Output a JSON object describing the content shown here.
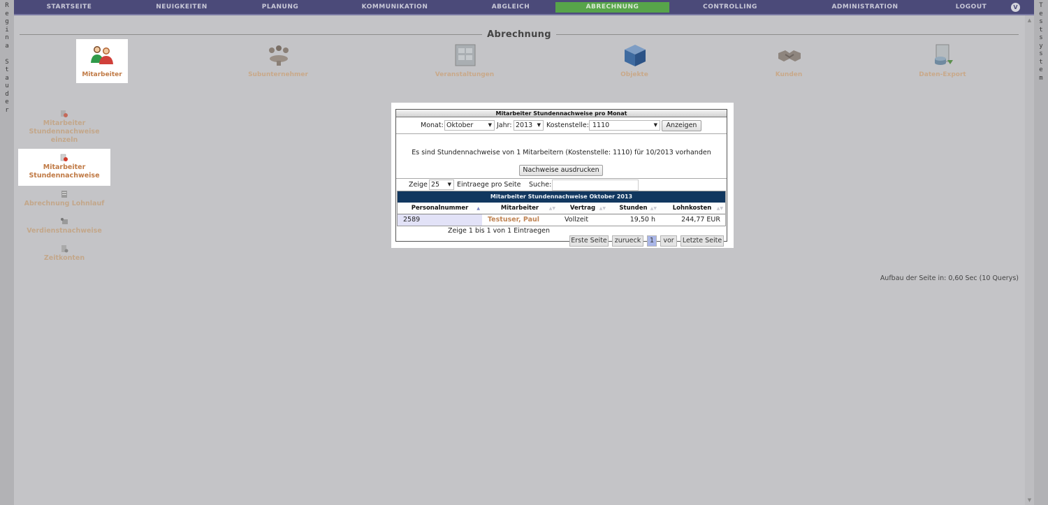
{
  "rails": {
    "left_text": [
      "R",
      "e",
      "g",
      "i",
      "n",
      "a",
      "",
      "S",
      "t",
      "a",
      "u",
      "d",
      "e",
      "r"
    ],
    "right_text": [
      "T",
      "e",
      "s",
      "t",
      "s",
      "y",
      "s",
      "t",
      "e",
      "m"
    ]
  },
  "topnav": {
    "items": [
      "STARTSEITE",
      "NEUIGKEITEN",
      "PLANUNG",
      "KOMMUNIKATION",
      "ABGLEICH",
      "ABRECHNUNG",
      "CONTROLLING",
      "ADMINISTRATION",
      "LOGOUT"
    ],
    "active_index": 5,
    "icon": "user-avatar-icon",
    "icon_glyph": "V"
  },
  "page": {
    "title": "Abrechnung"
  },
  "modules": [
    {
      "label": "Mitarbeiter",
      "icon": "employees-icon"
    },
    {
      "label": "Subunternehmer",
      "icon": "subcontractor-icon"
    },
    {
      "label": "Veranstaltungen",
      "icon": "events-icon"
    },
    {
      "label": "Objekte",
      "icon": "objects-cube-icon"
    },
    {
      "label": "Kunden",
      "icon": "customers-handshake-icon"
    },
    {
      "label": "Daten-Export",
      "icon": "data-export-icon"
    }
  ],
  "subnav": [
    {
      "line1": "Mitarbeiter",
      "line2": "Stundennachweise",
      "line3": "einzeln",
      "icon": "timesheet-single-icon"
    },
    {
      "line1": "Mitarbeiter",
      "line2": "Stundennachweise",
      "icon": "timesheet-icon"
    },
    {
      "line1": "Abrechnung Lohnlauf",
      "icon": "payroll-icon"
    },
    {
      "line1": "Verdienstnachweise",
      "icon": "earnings-icon"
    },
    {
      "line1": "Zeitkonten",
      "icon": "time-accounts-icon"
    }
  ],
  "footer_note": "Aufbau der Seite in: 0,60 Sec (10 Querys)",
  "panel": {
    "title": "Mitarbeiter Stundennachweise pro Monat",
    "monat_label": "Monat:",
    "monat_value": "Oktober",
    "jahr_label": "Jahr:",
    "jahr_value": "2013",
    "kostenstelle_label": "Kostenstelle:",
    "kostenstelle_value": "1110",
    "show_button": "Anzeigen",
    "info_text": "Es sind Stundennachweise von 1 Mitarbeitern (Kostenstelle: 1110) für 10/2013 vorhanden",
    "print_button": "Nachweise ausdrucken",
    "zeige_label": "Zeige",
    "page_size": "25",
    "entries_label": "Eintraege pro Seite",
    "search_label": "Suche:",
    "search_value": "",
    "table_title": "Mitarbeiter Stundennachweise Oktober 2013",
    "columns": [
      "Personalnummer",
      "Mitarbeiter",
      "Vertrag",
      "Stunden",
      "Lohnkosten"
    ],
    "rows": [
      {
        "personalnummer": "2589",
        "mitarbeiter": "Testuser, Paul",
        "vertrag": "Vollzeit",
        "stunden": "19,50 h",
        "lohnkosten": "244,77 EUR"
      }
    ],
    "table_info": "Zeige 1 bis 1 von 1 Eintraegen",
    "pagination": {
      "first": "Erste Seite",
      "prev": "zurueck",
      "current": "1",
      "next": "vor",
      "last": "Letzte Seite"
    }
  },
  "colors": {
    "nav_bg": "#4b4a79",
    "nav_active": "#57a44a",
    "table_header": "#11375f",
    "link": "#c08454"
  }
}
